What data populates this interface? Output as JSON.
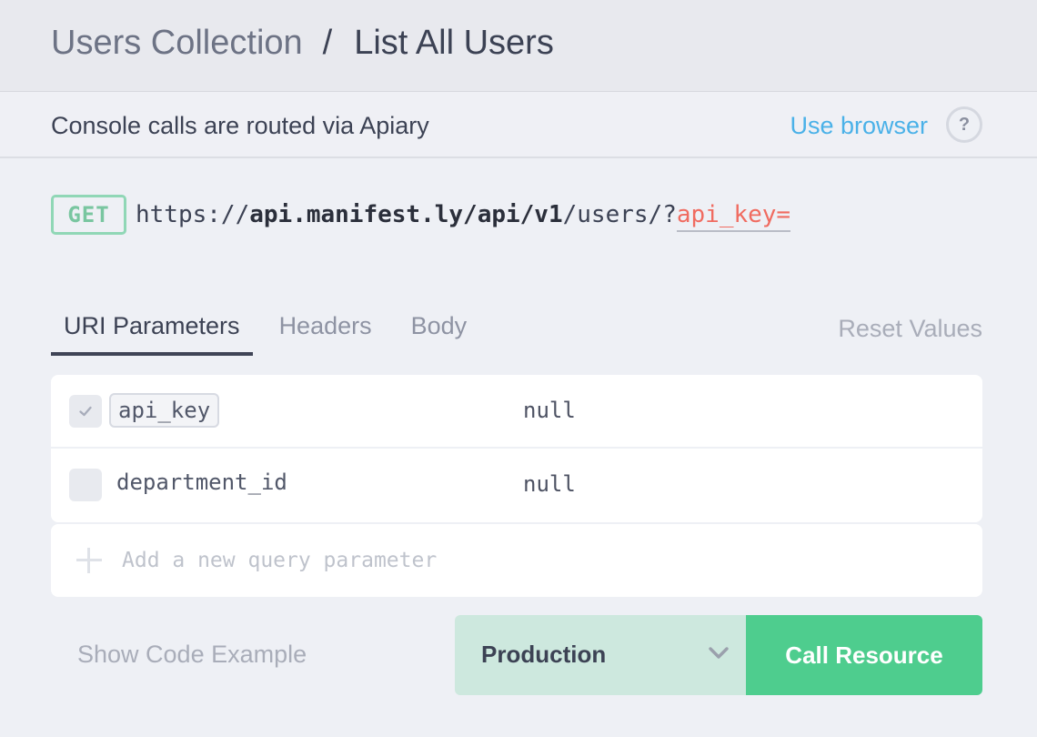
{
  "breadcrumb": {
    "parent": "Users Collection",
    "separator": "/",
    "current": "List All Users"
  },
  "routing": {
    "message": "Console calls are routed via Apiary",
    "use_browser": "Use browser",
    "help": "?"
  },
  "request": {
    "method": "GET",
    "url_protocol": "https://",
    "url_host_path": "api.manifest.ly/api/v1",
    "url_slash1": "/",
    "url_resource": "users",
    "url_slash2": "/?",
    "url_query_param": "api_key="
  },
  "tabs": [
    {
      "label": "URI Parameters",
      "active": true
    },
    {
      "label": "Headers",
      "active": false
    },
    {
      "label": "Body",
      "active": false
    }
  ],
  "reset_label": "Reset Values",
  "parameters": [
    {
      "name": "api_key",
      "value": "null",
      "checked": true
    },
    {
      "name": "department_id",
      "value": "null",
      "checked": false
    }
  ],
  "add_parameter": {
    "placeholder": "Add a new query parameter"
  },
  "footer": {
    "show_code": "Show Code Example",
    "environment": "Production",
    "call_button": "Call Resource"
  },
  "colors": {
    "accent_green": "#4ecd8e",
    "link_blue": "#4ab1e8",
    "param_red": "#f06b60"
  }
}
